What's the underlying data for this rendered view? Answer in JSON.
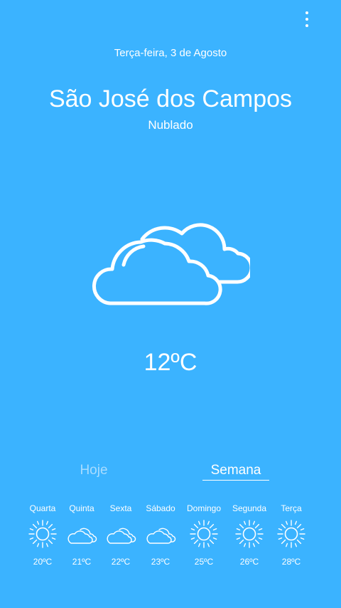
{
  "header": {
    "date": "Terça-feira, 3 de Agosto",
    "menu_icon": "more-vert-icon"
  },
  "location": {
    "city": "São José dos Campos",
    "condition": "Nublado"
  },
  "current": {
    "icon": "cloudy-icon",
    "temperature": "12ºC"
  },
  "tabs": {
    "today": "Hoje",
    "week": "Semana",
    "selected": "week"
  },
  "forecast": [
    {
      "day": "Quarta",
      "icon": "sun-icon",
      "temp": "20ºC"
    },
    {
      "day": "Quinta",
      "icon": "cloud-icon",
      "temp": "21ºC"
    },
    {
      "day": "Sexta",
      "icon": "cloud-icon",
      "temp": "22ºC"
    },
    {
      "day": "Sábado",
      "icon": "cloud-icon",
      "temp": "23ºC"
    },
    {
      "day": "Domingo",
      "icon": "sun-icon",
      "temp": "25ºC"
    },
    {
      "day": "Segunda",
      "icon": "sun-icon",
      "temp": "26ºC"
    },
    {
      "day": "Terça",
      "icon": "sun-icon",
      "temp": "28ºC"
    }
  ],
  "colors": {
    "background": "#3bb3ff",
    "text": "#ffffff",
    "inactive_tab": "#a8dcff"
  }
}
